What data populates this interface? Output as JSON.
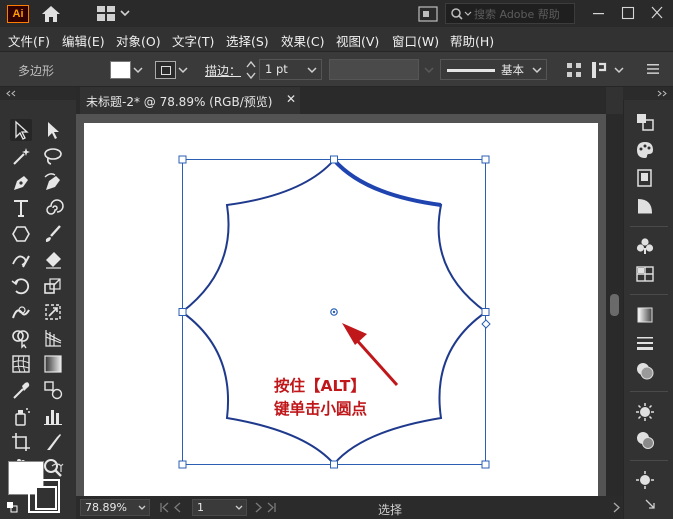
{
  "app": {
    "logo_text": "Ai"
  },
  "titlebar": {
    "search_placeholder": "搜索 Adobe 帮助"
  },
  "menu": [
    {
      "label": "文件(F)"
    },
    {
      "label": "编辑(E)"
    },
    {
      "label": "对象(O)"
    },
    {
      "label": "文字(T)"
    },
    {
      "label": "选择(S)"
    },
    {
      "label": "效果(C)"
    },
    {
      "label": "视图(V)"
    },
    {
      "label": "窗口(W)"
    },
    {
      "label": "帮助(H)"
    }
  ],
  "control": {
    "shape_label": "多边形",
    "stroke_label": "描边：",
    "stroke_weight": "1 pt",
    "brush_label": "基本"
  },
  "document": {
    "tab_title": "未标题-2* @ 78.89% (RGB/预览)",
    "close_glyph": "✕"
  },
  "annotation": {
    "line1": "按住【ALT】",
    "line2": "键单击小圆点"
  },
  "status": {
    "zoom": "78.89%",
    "artboard": "1",
    "tool": "选择"
  },
  "colors": {
    "shape_stroke": "#1f3a8c",
    "selection": "#2a5fb5",
    "annotation": "#c0171b"
  }
}
